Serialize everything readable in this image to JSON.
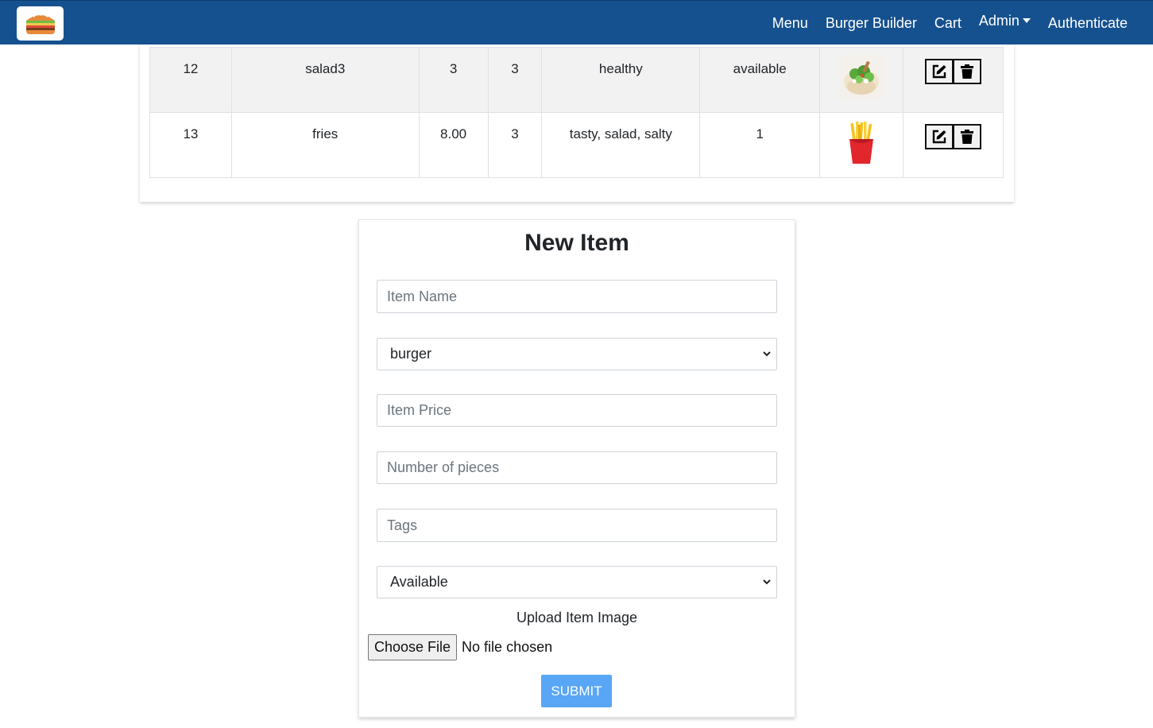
{
  "navbar": {
    "logo_icon": "burger-logo-icon",
    "links": [
      "Menu",
      "Burger Builder",
      "Cart",
      "Admin",
      "Authenticate"
    ],
    "color": "#16518f"
  },
  "items_table": {
    "rows": [
      {
        "id": "12",
        "name": "salad3",
        "price": "3",
        "pieces": "3",
        "tags": "healthy",
        "status": "available",
        "image": "salad-icon"
      },
      {
        "id": "13",
        "name": "fries",
        "price": "8.00",
        "pieces": "3",
        "tags": "tasty, salad, salty",
        "status": "1",
        "image": "fries-icon"
      }
    ],
    "actions": [
      "edit-icon",
      "trash-icon"
    ]
  },
  "form": {
    "title": "New Item",
    "name_placeholder": "Item Name",
    "category_selected": "burger",
    "price_placeholder": "Item Price",
    "pieces_placeholder": "Number of pieces",
    "tags_placeholder": "Tags",
    "availability_selected": "Available",
    "upload_label": "Upload Item Image",
    "file_button": "Choose File",
    "file_status": "No file chosen",
    "submit_label": "SUBMIT",
    "submit_color": "#58a6f5"
  }
}
